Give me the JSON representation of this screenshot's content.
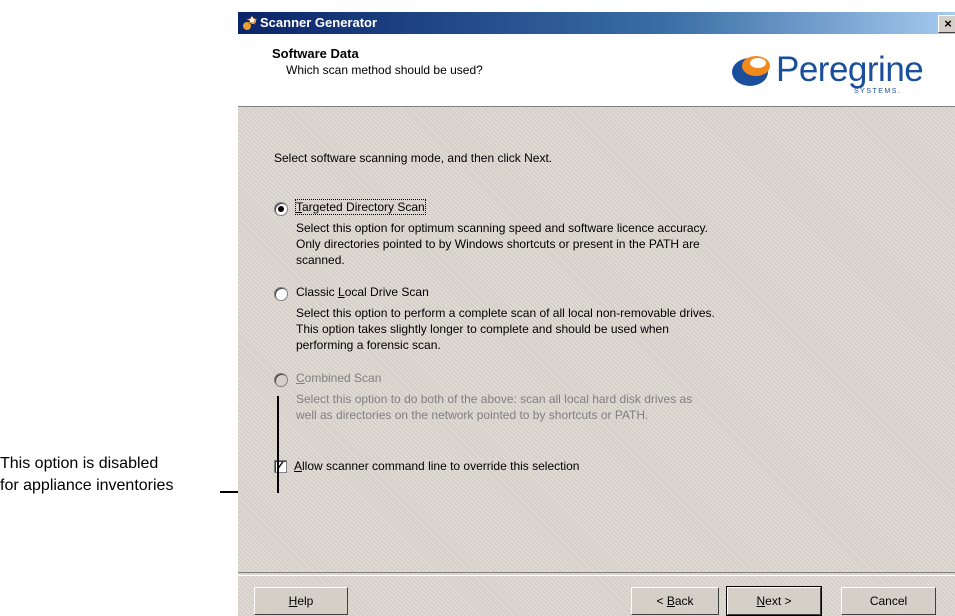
{
  "callout": {
    "line1": "This option is disabled",
    "line2": "for appliance inventories"
  },
  "window": {
    "title": "Scanner Generator",
    "close_glyph": "×"
  },
  "header": {
    "title": "Software Data",
    "subtitle": "Which scan method should be used?",
    "logo_text": "Peregrine",
    "logo_subtext": "SYSTEMS."
  },
  "content": {
    "intro": "Select software scanning mode, and then click Next.",
    "options": [
      {
        "label_pre": "",
        "label_key": "T",
        "label_post": "argeted Directory Scan",
        "selected": true,
        "enabled": true,
        "desc_lines": [
          "Select this option for optimum scanning speed and software licence accuracy.",
          "Only directories pointed to by Windows shortcuts or present in the PATH are",
          "scanned."
        ]
      },
      {
        "label_pre": "Classic ",
        "label_key": "L",
        "label_post": "ocal Drive Scan",
        "selected": false,
        "enabled": true,
        "desc_lines": [
          "Select this option to perform a complete scan of all local non-removable drives.",
          "This option takes slightly longer to complete and should be used when",
          "performing a forensic scan."
        ]
      },
      {
        "label_pre": "",
        "label_key": "C",
        "label_post": "ombined Scan",
        "selected": false,
        "enabled": false,
        "desc_lines": [
          "Select this option to do both of the above: scan all local hard disk drives as",
          "well as directories on the network pointed to by shortcuts or PATH."
        ]
      }
    ],
    "checkbox": {
      "label_key": "A",
      "label_post": "llow scanner command line to override this selection",
      "checked": true,
      "mark": "✓"
    }
  },
  "buttons": {
    "help_key": "H",
    "help_post": "elp",
    "back_pre": "< ",
    "back_key": "B",
    "back_post": "ack",
    "next_key": "N",
    "next_post": "ext >",
    "cancel": "Cancel"
  }
}
